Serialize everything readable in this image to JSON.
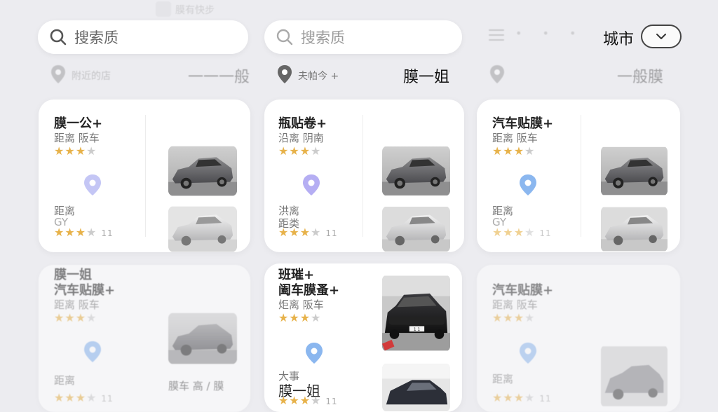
{
  "header": {
    "top_text": "膜有快步",
    "search1_placeholder": "搜索质",
    "search2_placeholder": "搜索质",
    "dots": "• • •",
    "city_label": "城市"
  },
  "locrows": [
    {
      "loc_text": "附近的店",
      "right_label": "一一一般"
    },
    {
      "loc_text": "夫帕今 +",
      "right_label": "膜一姐"
    },
    {
      "loc_text": "",
      "right_label": "一般膜"
    }
  ],
  "cards": [
    {
      "title": "膜一公+",
      "sub": "距离 阪车",
      "stars_full": "★★★",
      "stars_empty": "★",
      "lower1": "距离",
      "lower2": "GY",
      "lower_stars": "★★★",
      "lower_stars_half": "★",
      "lower_count": "11"
    },
    {
      "title": "瓶贴卷+",
      "sub": "沿离 阴南",
      "stars_full": "★★★",
      "stars_empty": "★",
      "lower1": "洪离",
      "lower2": "距类",
      "lower_stars": "★★★",
      "lower_stars_half": "★",
      "lower_count": "11"
    },
    {
      "title": "汽车贴膜+",
      "sub": "距离 阪车",
      "stars_full": "★★★",
      "stars_empty": "★",
      "lower1": "距离",
      "lower2": "GY",
      "lower_stars": "★★★",
      "lower_stars_half": "★",
      "lower_count": "11"
    },
    {
      "title": "膜一姐",
      "title2": "汽车贴膜+",
      "sub": "距离 阪车",
      "stars_full": "★★★",
      "stars_empty": "★",
      "lower1": "距离",
      "lower_stars": "★★★",
      "lower_stars_half": "★",
      "lower_count": "11",
      "right_text": "膜车 高 / 膜"
    },
    {
      "title": "班璀+",
      "title2": "阖车膜蚤+",
      "sub": "炬离 阪车",
      "stars_full": "★★★",
      "stars_empty": "★",
      "lower1": "大事",
      "lower_big": "膜一姐",
      "lower_stars": "★★★",
      "lower_stars_half": "★",
      "lower_count": "11",
      "plate": "1 1"
    },
    {
      "title": "汽车贴膜+",
      "sub": "距离 阪车",
      "stars_full": "★★★",
      "stars_empty": "★",
      "lower1": "距离",
      "lower_stars": "★★★",
      "lower_stars_half": "★",
      "lower_count": "11"
    }
  ],
  "colors": {
    "accent_star": "#e7b24a",
    "pin_blue": "#8bb7ef",
    "pin_purple": "#b9b3f3"
  }
}
